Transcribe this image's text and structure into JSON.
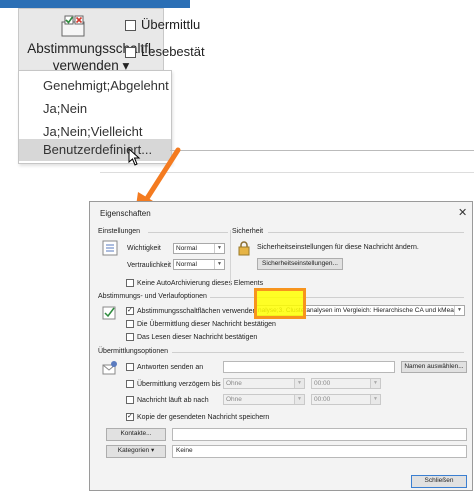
{
  "ribbon": {
    "vote_button_line1": "Abstimmungsschaltfl.",
    "vote_button_line2": "verwenden ▾",
    "checkbox1_label": "Übermittlu",
    "checkbox2_label": "Lesebestät"
  },
  "menu": {
    "items": [
      "Genehmigt;Abgelehnt",
      "Ja;Nein",
      "Ja;Nein;Vielleicht",
      "Benutzerdefiniert..."
    ],
    "selected_index": 3
  },
  "accent_arrow_color": "#f47b20",
  "dialog": {
    "title": "Eigenschaften",
    "close": "✕",
    "einstellungen": {
      "header": "Einstellungen",
      "wichtigkeit_label": "Wichtigkeit",
      "wichtigkeit_value": "Normal",
      "vertraulichkeit_label": "Vertraulichkeit",
      "vertraulichkeit_value": "Normal",
      "autoarchiv_label": "Keine AutoArchivierung dieses Elements"
    },
    "sicherheit": {
      "header": "Sicherheit",
      "text": "Sicherheitseinstellungen für diese Nachricht ändern.",
      "button": "Sicherheitseinstellungen..."
    },
    "abstimmung": {
      "header": "Abstimmungs- und Verlaufoptionen",
      "vote_label": "Abstimmungsschaltflächen verwenden",
      "vote_value": "nalyse;3. Clusteranalysen im Vergleich: Hierarchische CA und kMeans",
      "delivery_label": "Die Übermittlung dieser Nachricht bestätigen",
      "read_label": "Das Lesen dieser Nachricht bestätigen"
    },
    "uebermittlung": {
      "header": "Übermittlungsoptionen",
      "reply_label": "Antworten senden an",
      "names_button": "Namen auswählen...",
      "delay_label": "Übermittlung verzögern bis",
      "expire_label": "Nachricht läuft ab nach",
      "date_placeholder": "Ohne",
      "time_placeholder": "00:00",
      "save_copy_label": "Kopie der gesendeten Nachricht speichern"
    },
    "kontakte_button": "Kontakte...",
    "kategorien_button": "Kategorien",
    "kategorien_value": "Keine",
    "close_button": "Schließen"
  }
}
